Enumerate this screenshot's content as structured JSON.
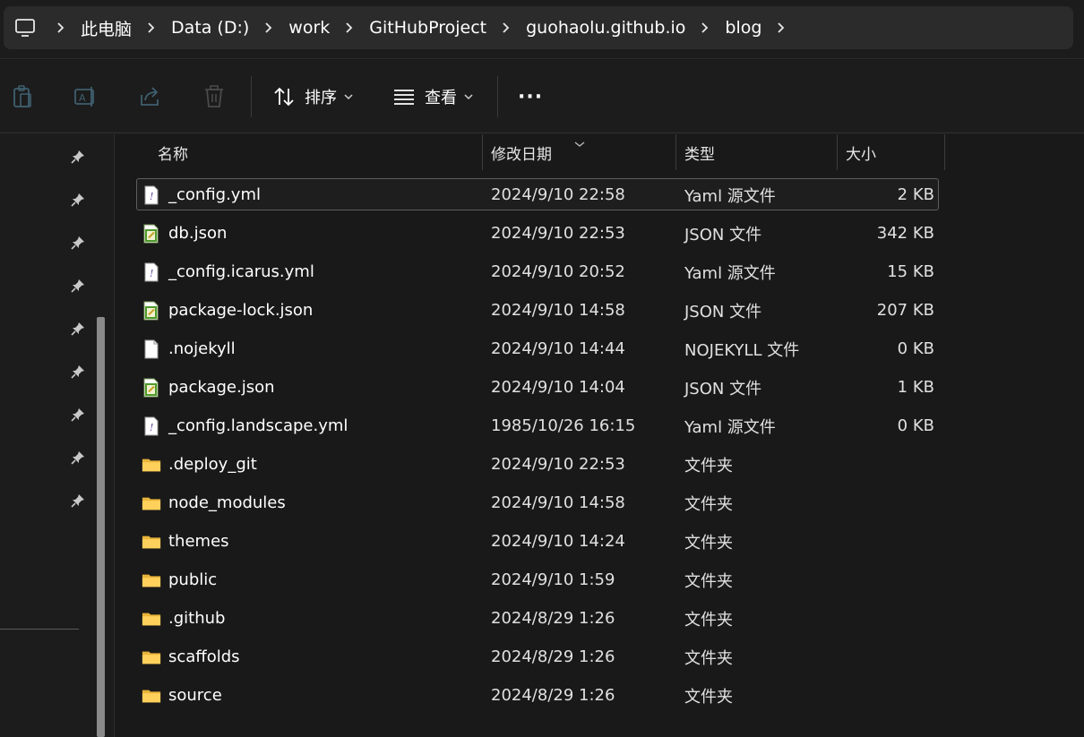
{
  "breadcrumb": {
    "items": [
      "此电脑",
      "Data (D:)",
      "work",
      "GitHubProject",
      "guohaolu.github.io",
      "blog"
    ]
  },
  "toolbar": {
    "copy_icon": "clipboard-icon",
    "rename_icon": "rename-icon",
    "share_icon": "share-icon",
    "delete_icon": "trash-icon",
    "sort_label": "排序",
    "view_label": "查看",
    "more_label": "···"
  },
  "columns": {
    "name": "名称",
    "date": "修改日期",
    "type": "类型",
    "size": "大小"
  },
  "files": [
    {
      "name": "_config.yml",
      "date": "2024/9/10 22:58",
      "type": "Yaml 源文件",
      "size": "2 KB",
      "icon": "yaml-file-icon",
      "selected": true
    },
    {
      "name": "db.json",
      "date": "2024/9/10 22:53",
      "type": "JSON 文件",
      "size": "342 KB",
      "icon": "json-file-icon"
    },
    {
      "name": "_config.icarus.yml",
      "date": "2024/9/10 20:52",
      "type": "Yaml 源文件",
      "size": "15 KB",
      "icon": "yaml-file-icon"
    },
    {
      "name": "package-lock.json",
      "date": "2024/9/10 14:58",
      "type": "JSON 文件",
      "size": "207 KB",
      "icon": "json-file-icon"
    },
    {
      "name": ".nojekyll",
      "date": "2024/9/10 14:44",
      "type": "NOJEKYLL 文件",
      "size": "0 KB",
      "icon": "blank-file-icon"
    },
    {
      "name": "package.json",
      "date": "2024/9/10 14:04",
      "type": "JSON 文件",
      "size": "1 KB",
      "icon": "json-file-icon"
    },
    {
      "name": "_config.landscape.yml",
      "date": "1985/10/26 16:15",
      "type": "Yaml 源文件",
      "size": "0 KB",
      "icon": "yaml-file-icon"
    },
    {
      "name": ".deploy_git",
      "date": "2024/9/10 22:53",
      "type": "文件夹",
      "size": "",
      "icon": "folder-icon"
    },
    {
      "name": "node_modules",
      "date": "2024/9/10 14:58",
      "type": "文件夹",
      "size": "",
      "icon": "folder-icon"
    },
    {
      "name": "themes",
      "date": "2024/9/10 14:24",
      "type": "文件夹",
      "size": "",
      "icon": "folder-icon"
    },
    {
      "name": "public",
      "date": "2024/9/10 1:59",
      "type": "文件夹",
      "size": "",
      "icon": "folder-icon"
    },
    {
      "name": ".github",
      "date": "2024/8/29 1:26",
      "type": "文件夹",
      "size": "",
      "icon": "folder-icon"
    },
    {
      "name": "scaffolds",
      "date": "2024/8/29 1:26",
      "type": "文件夹",
      "size": "",
      "icon": "folder-icon"
    },
    {
      "name": "source",
      "date": "2024/8/29 1:26",
      "type": "文件夹",
      "size": "",
      "icon": "folder-icon"
    }
  ]
}
